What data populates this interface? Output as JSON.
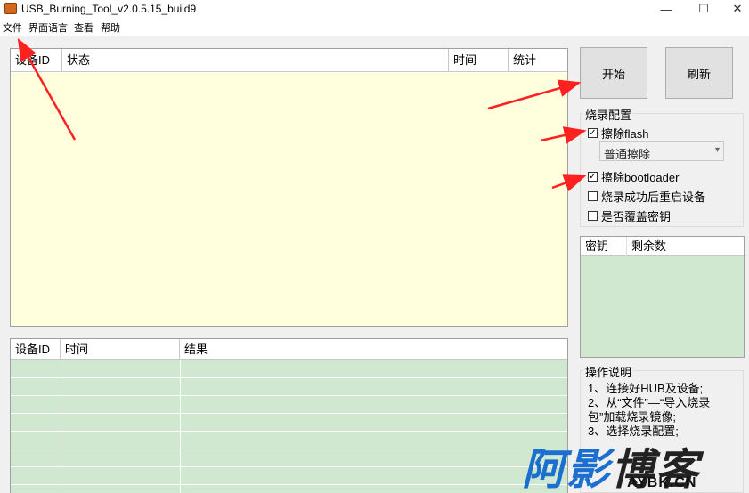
{
  "window": {
    "title": "USB_Burning_Tool_v2.0.5.15_build9",
    "controls": {
      "minimize": "—",
      "maximize": "☐",
      "close": "✕"
    }
  },
  "menu": [
    "文件",
    "界面语言",
    "查看",
    "帮助"
  ],
  "device_table": {
    "columns": [
      "设备ID",
      "状态",
      "时间",
      "统计"
    ]
  },
  "result_table": {
    "columns": [
      "设备ID",
      "时间",
      "结果"
    ]
  },
  "buttons": {
    "start": "开始",
    "refresh": "刷新"
  },
  "burn_config": {
    "title": "烧录配置",
    "options": [
      {
        "label": "擦除flash",
        "checked": true
      },
      {
        "label": "擦除bootloader",
        "checked": true
      },
      {
        "label": "烧录成功后重启设备",
        "checked": false
      },
      {
        "label": "是否覆盖密钥",
        "checked": false
      }
    ],
    "erase_mode": "普通擦除"
  },
  "key_table": {
    "columns": [
      "密钥",
      "剩余数"
    ]
  },
  "instructions": {
    "title": "操作说明",
    "lines": [
      "1、连接好HUB及设备;",
      "2、从“文件”—“导入烧录",
      "包”加载烧录镜像;",
      "3、选择烧录配置;"
    ]
  },
  "watermark": {
    "text_a": "阿影",
    "text_b": "博客",
    "url": "AYBK.CN"
  },
  "colors": {
    "annotation_arrow": "#ff2020",
    "device_table_bg": "#ffffdd",
    "green_table_bg": "#d0e8d0"
  }
}
